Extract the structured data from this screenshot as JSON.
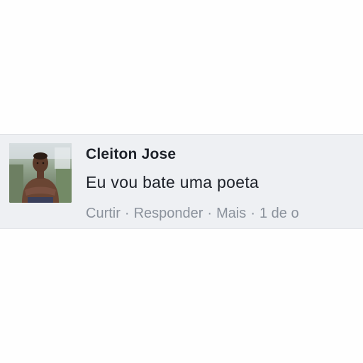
{
  "comment": {
    "author": "Cleiton Jose",
    "text": "Eu vou bate uma poeta",
    "actions": {
      "like": "Curtir",
      "reply": "Responder",
      "more": "Mais",
      "timestamp": "1 de o",
      "separator": "·"
    },
    "avatar_icon": "profile-photo"
  },
  "colors": {
    "card_background": "#eef0f3",
    "name_color": "#1d2129",
    "action_color": "#8b929c"
  }
}
